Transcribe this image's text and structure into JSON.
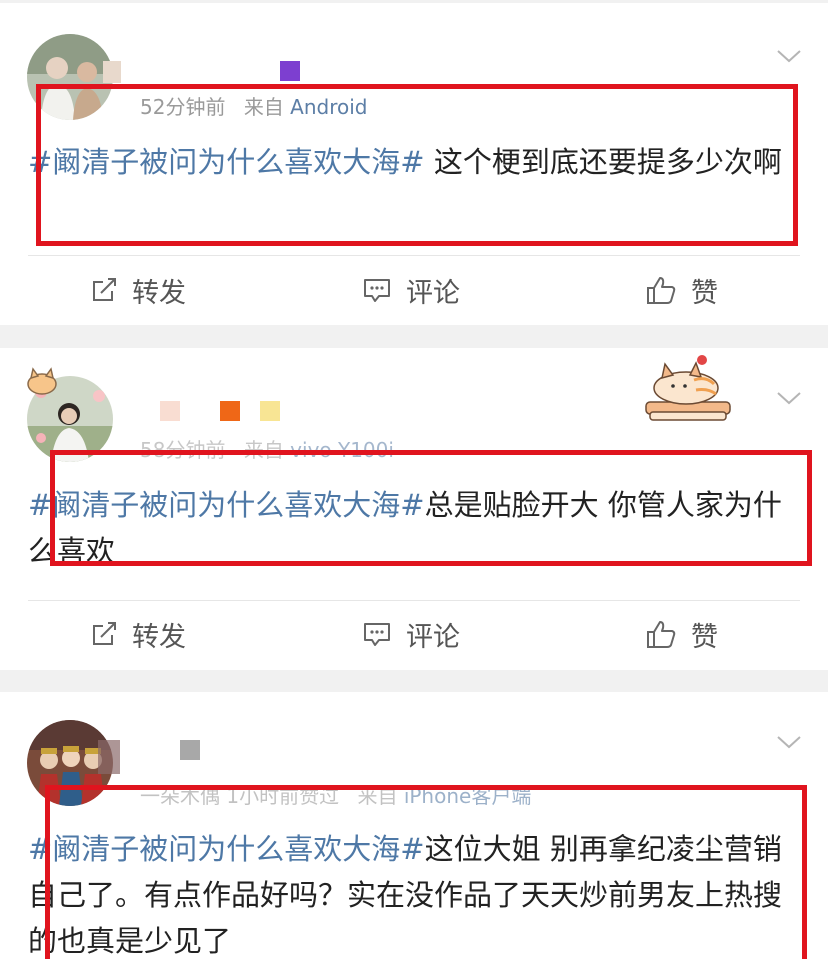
{
  "posts": [
    {
      "meta": "52分钟前",
      "source_label": "来自",
      "source": "Android",
      "topic": "#阚清子被问为什么喜欢大海#",
      "text": " 这个梗到底还要提多少次啊",
      "actions": [
        "转发",
        "评论",
        "赞"
      ]
    },
    {
      "meta": "58分钟前",
      "source_label": "来自",
      "source": "vivo Y100i",
      "topic": "#阚清子被问为什么喜欢大海#",
      "text": "总是贴脸开大 你管人家为什么喜欢",
      "actions": [
        "转发",
        "评论",
        "赞"
      ]
    },
    {
      "meta": "一朵木偶 1小时前赞过",
      "source_label": "来自",
      "source": "iPhone客户端",
      "topic": "#阚清子被问为什么喜欢大海#",
      "text": "这位大姐 别再拿纪凌尘营销自己了。有点作品好吗？实在没作品了天天炒前男友上热搜的也真是少见了",
      "actions": []
    }
  ],
  "colors": {
    "topic": "#4e78a6",
    "highlight_box": "#e0141e",
    "page_bg": "#f1f1f1"
  },
  "icons": [
    "chevron-down-icon",
    "repost-icon",
    "comment-icon",
    "like-icon"
  ]
}
